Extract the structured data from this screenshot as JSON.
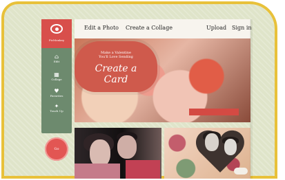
{
  "header": {
    "nav": [
      "Edit a Photo",
      "Create a Collage",
      "Upload",
      "Sign in"
    ]
  },
  "brand": {
    "name": "PicMonkey"
  },
  "sidebar": {
    "items": [
      {
        "label": "Edit",
        "icon": "camera-icon"
      },
      {
        "label": "Collage",
        "icon": "grid-icon"
      },
      {
        "label": "Favorites",
        "icon": "heart-icon"
      },
      {
        "label": "Touch Up",
        "icon": "brush-icon"
      }
    ],
    "badge": "Go"
  },
  "hero": {
    "line1": "Make a Valentine",
    "line2": "You'll Love Sending",
    "headline": "Create a Card"
  }
}
